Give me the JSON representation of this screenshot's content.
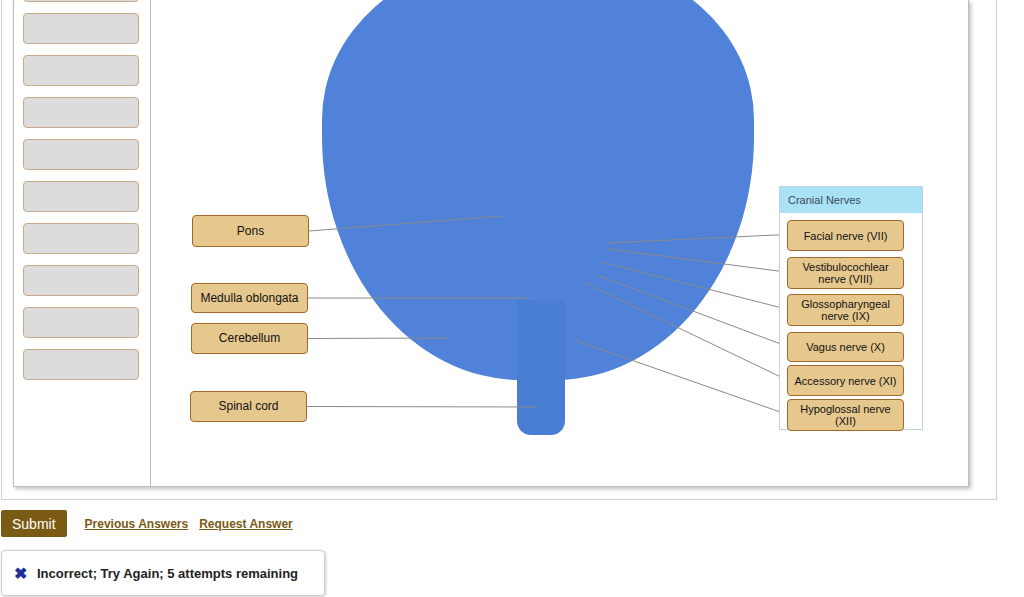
{
  "slots": [
    {
      "filled": false
    },
    {
      "filled": false
    },
    {
      "filled": false
    },
    {
      "filled": false
    },
    {
      "filled": false
    },
    {
      "filled": false
    },
    {
      "filled": false
    },
    {
      "filled": false
    },
    {
      "filled": false
    },
    {
      "filled": false
    }
  ],
  "structures": [
    {
      "label": "Pons"
    },
    {
      "label": "Medulla oblongata"
    },
    {
      "label": "Cerebellum"
    },
    {
      "label": "Spinal cord"
    }
  ],
  "cranial_nerves": {
    "title": "Cranial Nerves",
    "items": [
      {
        "label": "Facial nerve (VII)"
      },
      {
        "label": "Vestibulocochlear nerve (VIII)"
      },
      {
        "label": "Glossopharyngeal nerve (IX)"
      },
      {
        "label": "Vagus nerve (X)"
      },
      {
        "label": "Accessory nerve (XI)"
      },
      {
        "label": "Hypoglossal nerve (XII)"
      }
    ]
  },
  "submit": "Submit",
  "links": [
    "Previous Answers",
    "Request Answer"
  ],
  "feedback": {
    "icon": "✖",
    "message": "Incorrect; Try Again; 5 attempts remaining"
  }
}
